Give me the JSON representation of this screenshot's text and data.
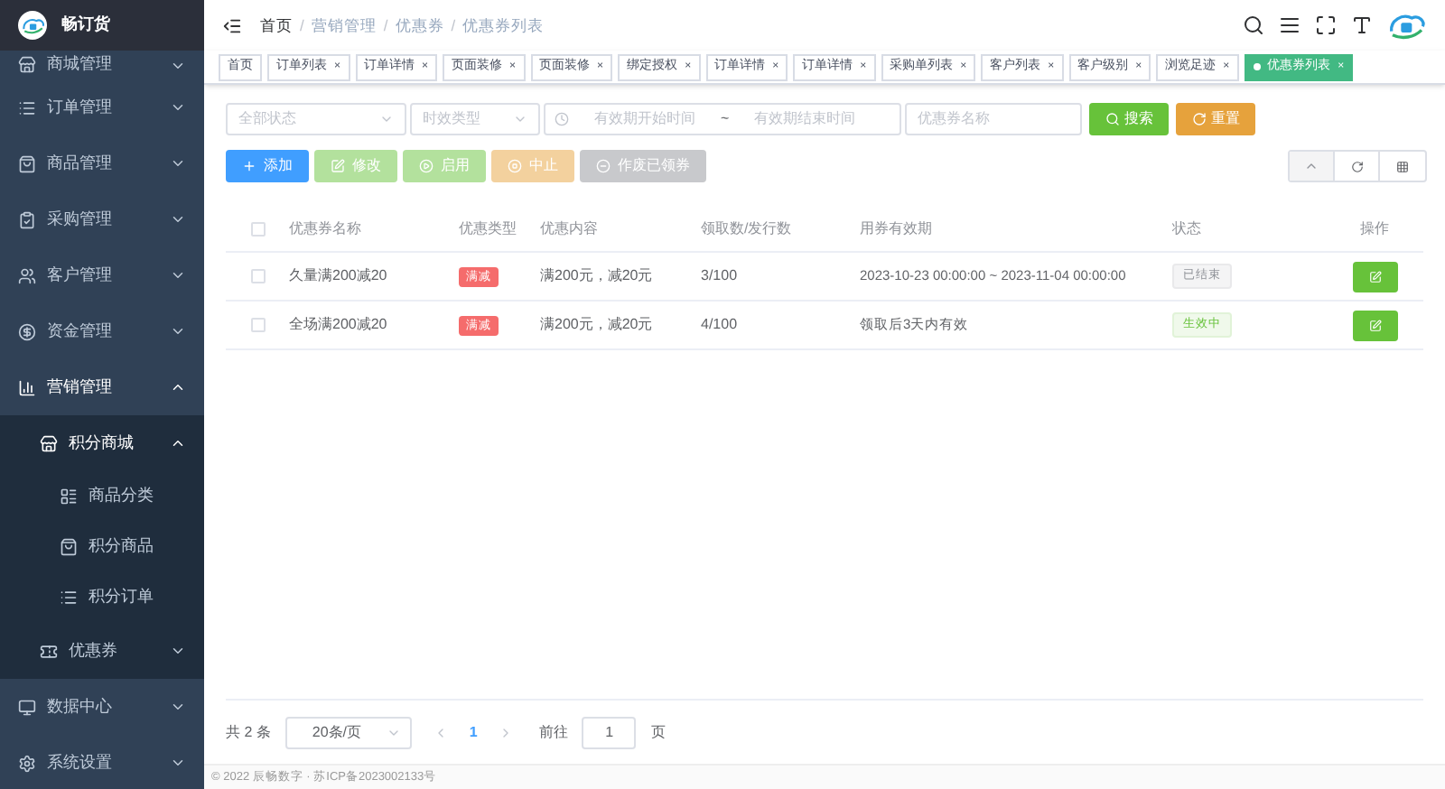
{
  "sidebar": {
    "brand": "畅订货",
    "items": [
      {
        "label": "商城管理",
        "expanded": false
      },
      {
        "label": "订单管理",
        "expanded": false
      },
      {
        "label": "商品管理",
        "expanded": false
      },
      {
        "label": "采购管理",
        "expanded": false
      },
      {
        "label": "客户管理",
        "expanded": false
      },
      {
        "label": "资金管理",
        "expanded": false
      },
      {
        "label": "营销管理",
        "expanded": true,
        "children": [
          {
            "label": "积分商城",
            "expanded": true,
            "children": [
              {
                "label": "商品分类"
              },
              {
                "label": "积分商品"
              },
              {
                "label": "积分订单"
              }
            ]
          },
          {
            "label": "优惠券",
            "expanded": false
          }
        ]
      },
      {
        "label": "数据中心",
        "expanded": false
      },
      {
        "label": "系统设置",
        "expanded": false
      }
    ]
  },
  "breadcrumb": {
    "separator": "/",
    "items": [
      "首页",
      "营销管理",
      "优惠券",
      "优惠券列表"
    ]
  },
  "tags": [
    {
      "label": "首页",
      "selected": false
    },
    {
      "label": "订单列表",
      "close": "×",
      "selected": false
    },
    {
      "label": "订单详情",
      "close": "×",
      "selected": false
    },
    {
      "label": "页面装修",
      "close": "×",
      "selected": false
    },
    {
      "label": "页面装修",
      "close": "×",
      "selected": false
    },
    {
      "label": "绑定授权",
      "close": "×",
      "selected": false
    },
    {
      "label": "订单详情",
      "close": "×",
      "selected": false
    },
    {
      "label": "订单详情",
      "close": "×",
      "selected": false
    },
    {
      "label": "采购单列表",
      "close": "×",
      "selected": false
    },
    {
      "label": "客户列表",
      "close": "×",
      "selected": false
    },
    {
      "label": "客户级别",
      "close": "×",
      "selected": false
    },
    {
      "label": "浏览足迹",
      "close": "×",
      "selected": false
    },
    {
      "label": "优惠券列表",
      "close": "×",
      "selected": true
    }
  ],
  "filters": {
    "status": {
      "placeholder": "全部状态"
    },
    "type": {
      "placeholder": "时效类型"
    },
    "start": {
      "placeholder": "有效期开始时间"
    },
    "separator": "~",
    "end": {
      "placeholder": "有效期结束时间"
    },
    "name": {
      "placeholder": "优惠券名称"
    },
    "search": "搜索",
    "reset": "重置"
  },
  "actions": [
    {
      "label": "添加",
      "kind": "add",
      "disabled": false
    },
    {
      "label": "修改",
      "kind": "edit",
      "disabled": true
    },
    {
      "label": "启用",
      "kind": "enable",
      "disabled": true
    },
    {
      "label": "中止",
      "kind": "stop",
      "disabled": true
    },
    {
      "label": "作废已领券",
      "kind": "void",
      "disabled": true
    }
  ],
  "table": {
    "all_checked": false,
    "columns": [
      "优惠券名称",
      "优惠类型",
      "优惠内容",
      "领取数/发行数",
      "用券有效期",
      "状态",
      "操作"
    ],
    "rows": [
      {
        "checked": false,
        "name": "久量满200减20",
        "type": "满减",
        "content": "满200元，减20元",
        "count": "3/100",
        "period": "2023-10-23 00:00:00 ~ 2023-11-04 00:00:00",
        "status": {
          "label": "已结束",
          "kind": "ended"
        }
      },
      {
        "checked": false,
        "name": "全场满200减20",
        "type": "满减",
        "content": "满200元，减20元",
        "count": "4/100",
        "period": "领取后3天内有效",
        "status": {
          "label": "生效中",
          "kind": "active"
        }
      }
    ]
  },
  "pagination": {
    "total": "共 2 条",
    "page_size": "20条/页",
    "pages": [
      {
        "label": "1",
        "selected": true
      }
    ],
    "goto": "前往",
    "goto_value": "1",
    "page_unit": "页"
  },
  "footer": "© 2022 辰畅数字 · 苏ICP备2023002133号"
}
